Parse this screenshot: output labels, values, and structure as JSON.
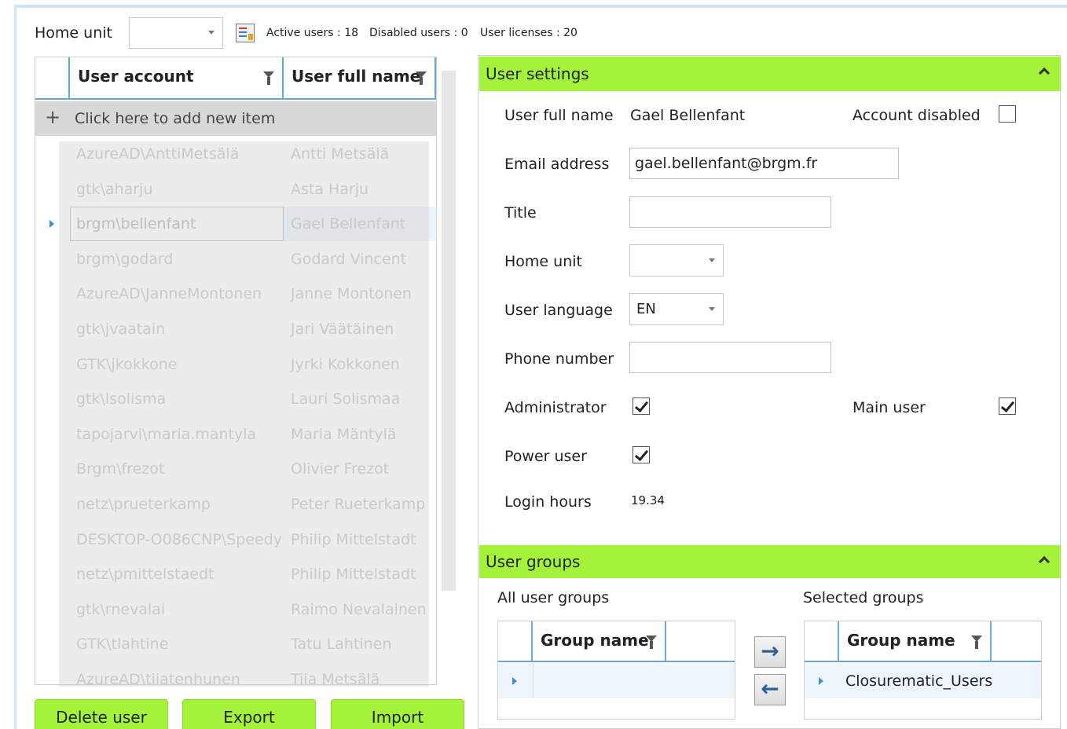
{
  "toolbar": {
    "home_unit_label": "Home unit",
    "home_unit_value": "",
    "active_users": "Active users : 18",
    "disabled_users": "Disabled users : 0",
    "user_licenses": "User licenses : 20"
  },
  "user_grid": {
    "col_account": "User account",
    "col_fullname": "User full name",
    "add_new": "Click here to add new item",
    "rows": [
      {
        "account": "AzureAD\\AnttiMetsälä",
        "name": "Antti Metsälä"
      },
      {
        "account": "gtk\\aharju",
        "name": "Asta Harju"
      },
      {
        "account": "brgm\\bellenfant",
        "name": "Gael Bellenfant"
      },
      {
        "account": "brgm\\godard",
        "name": "Godard Vincent"
      },
      {
        "account": "AzureAD\\JanneMontonen",
        "name": "Janne Montonen"
      },
      {
        "account": "gtk\\jvaatain",
        "name": "Jari Väätäinen"
      },
      {
        "account": "GTK\\jkokkone",
        "name": "Jyrki Kokkonen"
      },
      {
        "account": "gtk\\lsolisma",
        "name": "Lauri Solismaa"
      },
      {
        "account": "tapojarvi\\maria.mantyla",
        "name": "Maria Mäntylä"
      },
      {
        "account": "Brgm\\frezot",
        "name": "Olivier Frezot"
      },
      {
        "account": "netz\\prueterkamp",
        "name": "Peter Rueterkamp"
      },
      {
        "account": "DESKTOP-O086CNP\\Speedy",
        "name": "Philip Mittelstadt"
      },
      {
        "account": "netz\\pmittelstaedt",
        "name": "Philip Mittelstadt"
      },
      {
        "account": "gtk\\rnevalai",
        "name": "Raimo Nevalainen"
      },
      {
        "account": "GTK\\tlahtine",
        "name": "Tatu Lahtinen"
      },
      {
        "account": "AzureAD\\tiiatenhunen",
        "name": "Tiia Metsälä"
      }
    ]
  },
  "buttons": {
    "delete": "Delete user",
    "export": "Export",
    "import": "Import"
  },
  "settings": {
    "header": "User settings",
    "full_name_label": "User full name",
    "full_name_value": "Gael Bellenfant",
    "account_disabled_label": "Account disabled",
    "account_disabled": false,
    "email_label": "Email address",
    "email_value": "gael.bellenfant@brgm.fr",
    "title_label": "Title",
    "title_value": "",
    "home_unit_label": "Home unit",
    "home_unit_value": "",
    "language_label": "User language",
    "language_value": "EN",
    "phone_label": "Phone number",
    "phone_value": "",
    "admin_label": "Administrator",
    "admin": true,
    "main_user_label": "Main user",
    "main_user": true,
    "power_user_label": "Power user",
    "power_user": true,
    "login_hours_label": "Login hours",
    "login_hours_value": "19.34"
  },
  "groups": {
    "header": "User groups",
    "all_label": "All user groups",
    "selected_label": "Selected groups",
    "col_group_name": "Group name",
    "all_rows": [
      ""
    ],
    "selected_rows": [
      "Closurematic_Users"
    ]
  },
  "colors": {
    "accent_green": "#a5f23a",
    "header_blue": "#6aa8d8"
  }
}
